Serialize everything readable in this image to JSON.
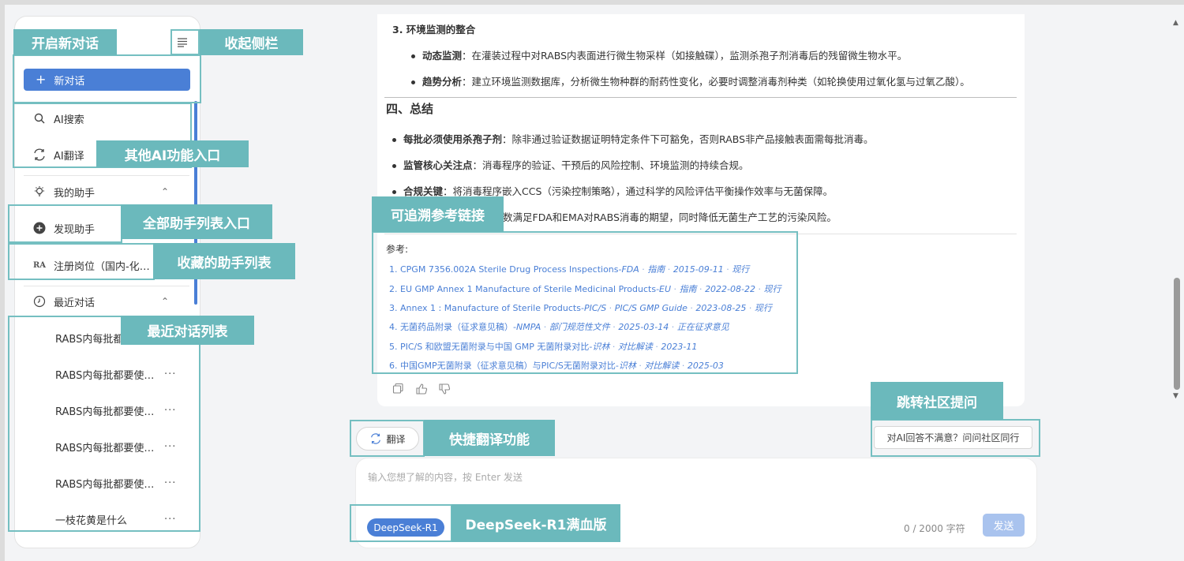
{
  "sidebar": {
    "new_chat_label": "新对话",
    "ai_search_label": "AI搜索",
    "ai_translate_label": "AI翻译",
    "my_assistants_label": "我的助手",
    "discover_label": "发现助手",
    "fav_assistant_prefix": "RA",
    "fav_assistant_label": "注册岗位（国内-化…",
    "recent_label": "最近对话",
    "caret": "⌃",
    "recent_items": [
      "RABS内每批都",
      "RABS内每批都要使…",
      "RABS内每批都要使…",
      "RABS内每批都要使…",
      "RABS内每批都要使…",
      "一枝花黄是什么"
    ],
    "more": "···"
  },
  "content": {
    "section3_title": "3. 环境监测的整合",
    "bullet_dynamic_bold": "动态监测",
    "bullet_dynamic_text": "：在灌装过程中对RABS内表面进行微生物采样（如接触碟），监测杀孢子剂消毒后的残留微生物水平。",
    "bullet_trend_bold": "趋势分析",
    "bullet_trend_text": "：建立环境监测数据库，分析微生物种群的耐药性变化，必要时调整消毒剂种类（如轮换使用过氧化氢与过氧乙酸）。",
    "summary_title": "四、总结",
    "sum1_bold": "每批必须使用杀孢子剂",
    "sum1_text": "：除非通过验证数据证明特定条件下可豁免，否则RABS非产品接触表面需每批消毒。",
    "sum2_bold": "监管核心关注点",
    "sum2_text": "：消毒程序的验证、干预后的风险控制、环境监测的持续合规。",
    "sum3_bold": "合规关键",
    "sum3_text": "：将消毒程序嵌入CCS（污染控制策略），通过科学的风险评估平衡操作效率与无菌保障。",
    "sum4_text": "数满足FDA和EMA对RABS消毒的期望，同时降低无菌生产工艺的污染风险。",
    "refs_title": "参考:",
    "refs": [
      {
        "main": "1. CPGM 7356.002A Sterile Drug Process Inspections-",
        "src": "FDA",
        "type": "指南",
        "date": "2015-09-11",
        "status": "现行"
      },
      {
        "main": "2. EU GMP Annex 1 Manufacture of Sterile Medicinal Products-",
        "src": "EU",
        "type": "指南",
        "date": "2022-08-22",
        "status": "现行"
      },
      {
        "main": "3. Annex 1 : Manufacture of Sterile Products-",
        "src": "PIC/S",
        "type": "PIC/S GMP Guide",
        "date": "2023-08-25",
        "status": "现行"
      },
      {
        "main": "4. 无菌药品附录（征求意见稿）-",
        "src": "NMPA",
        "type": "部门规范性文件",
        "date": "2025-03-14",
        "status": "正在征求意见"
      },
      {
        "main": "5. PIC/S 和欧盟无菌附录与中国 GMP 无菌附录对比-",
        "src": "识林",
        "type": "对比解读",
        "date": "2023-11",
        "status": ""
      },
      {
        "main": "6. 中国GMP无菌附录（征求意见稿）与PIC/S无菌附录对比-",
        "src": "识林",
        "type": "对比解读",
        "date": "2025-03",
        "status": ""
      }
    ],
    "sep": " · "
  },
  "bottom": {
    "translate_label": "翻译",
    "community_label": "对AI回答不满意？问问社区同行",
    "input_placeholder": "输入您想了解的内容，按 Enter 发送",
    "model_label": "DeepSeek-R1",
    "char_count": "0 / 2000 字符",
    "send_label": "发送"
  },
  "annotations": {
    "new_chat": "开启新对话",
    "collapse": "收起侧栏",
    "other_ai": "其他AI功能入口",
    "all_assistants": "全部助手列表入口",
    "fav_assistants": "收藏的助手列表",
    "recent_list": "最近对话列表",
    "refs": "可追溯参考链接",
    "community": "跳转社区提问",
    "translate": "快捷翻译功能",
    "deepseek": "DeepSeek-R1满血版"
  },
  "colors": {
    "accent": "#4a7fd6",
    "annotation": "#6bb9bc",
    "annotation_border": "#75bfc1"
  }
}
